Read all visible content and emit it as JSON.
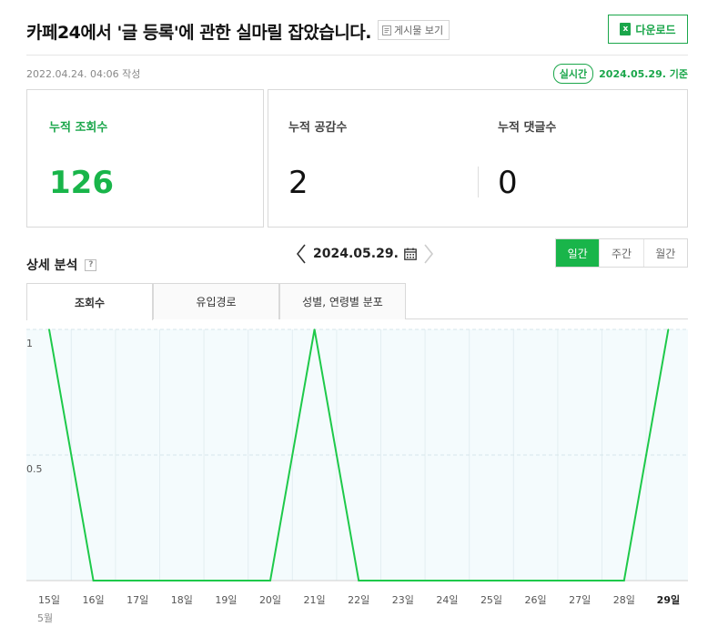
{
  "header": {
    "title": "카페24에서 '글 등록'에 관한 실마릴 잡았습니다.",
    "view_post_label": "게시물 보기",
    "download_label": "다운로드"
  },
  "meta": {
    "written_date": "2022.04.24. 04:06 작성",
    "realtime_badge": "실시간",
    "base_date": "2024.05.29. 기준"
  },
  "stats": {
    "views_label": "누적 조회수",
    "views_value": "126",
    "likes_label": "누적 공감수",
    "likes_value": "2",
    "comments_label": "누적 댓글수",
    "comments_value": "0"
  },
  "detail": {
    "title": "상세 분석",
    "help": "?",
    "current_date": "2024.05.29.",
    "period_tabs": [
      "일간",
      "주간",
      "월간"
    ],
    "active_period": 0,
    "tabs": [
      "조회수",
      "유입경로",
      "성별, 연령별 분포"
    ],
    "active_tab": 0
  },
  "colors": {
    "accent": "#19b54a",
    "line": "#1ec94a"
  },
  "icons": {
    "view_post": "document-icon",
    "download": "excel-icon",
    "calendar": "calendar-icon",
    "prev": "chevron-left-icon",
    "next": "chevron-right-icon"
  },
  "chart_data": {
    "type": "line",
    "x": [
      "15일",
      "16일",
      "17일",
      "18일",
      "19일",
      "20일",
      "21일",
      "22일",
      "23일",
      "24일",
      "25일",
      "26일",
      "27일",
      "28일",
      "29일"
    ],
    "month_label": "5월",
    "series": [
      {
        "values": [
          1,
          0,
          0,
          0,
          0,
          0,
          1,
          0,
          0,
          0,
          0,
          0,
          0,
          0,
          1
        ]
      }
    ],
    "y_ticks": [
      "1",
      "0.5"
    ],
    "ylim": [
      0,
      1
    ],
    "highlight_index": 14,
    "grid": true
  }
}
